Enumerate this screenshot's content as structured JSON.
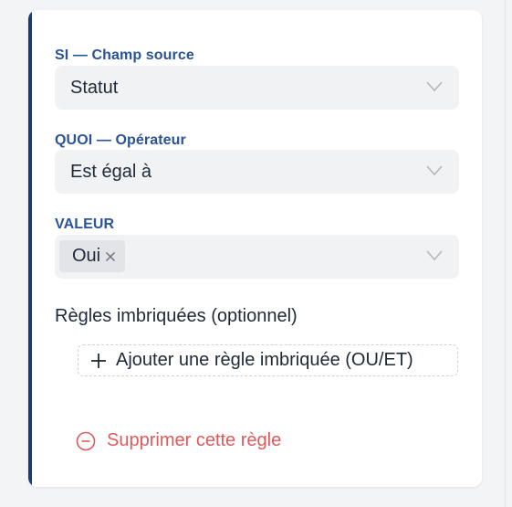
{
  "rule": {
    "source_field": {
      "label": "SI — Champ source",
      "value": "Statut",
      "icon": "chevron-down-icon"
    },
    "operator": {
      "label": "QUOI — Opérateur",
      "value": "Est égal à",
      "icon": "chevron-down-icon"
    },
    "value": {
      "label": "VALEUR",
      "chips": [
        "Oui"
      ],
      "icon": "chevron-down-icon"
    },
    "nested": {
      "title": "Règles imbriquées (optionnel)",
      "add_label": "Ajouter une règle imbriquée (OU/ET)"
    },
    "delete_label": "Supprimer cette règle"
  },
  "colors": {
    "accent_bar": "#1e3a6e",
    "label": "#2a5496",
    "danger": "#e05a5a",
    "field_bg": "#f1f2f4"
  }
}
